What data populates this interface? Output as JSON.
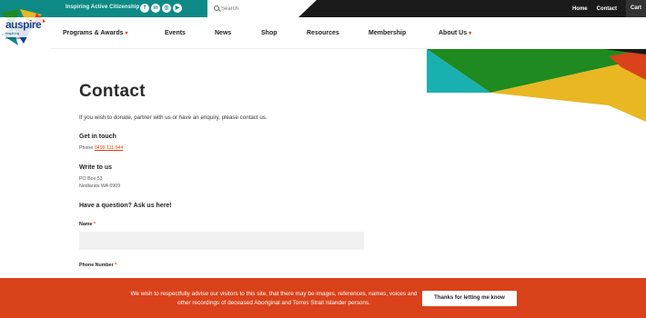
{
  "topbar": {
    "tagline": "Inspiring Active Citizenship",
    "social_icons": [
      "facebook-icon",
      "linkedin-icon",
      "instagram-icon",
      "youtube-icon"
    ],
    "search_placeholder": "Search",
    "links": [
      "Home",
      "Contact"
    ],
    "cart": "Cart"
  },
  "logo": {
    "name": "auspire",
    "sub": [
      "Inspiring",
      "Australians"
    ]
  },
  "nav": {
    "items": [
      {
        "label": "Programs & Awards",
        "dropdown": true
      },
      {
        "label": "Events",
        "dropdown": false
      },
      {
        "label": "News",
        "dropdown": false
      },
      {
        "label": "Shop",
        "dropdown": false
      },
      {
        "label": "Resources",
        "dropdown": false
      },
      {
        "label": "Membership",
        "dropdown": false
      },
      {
        "label": "About Us",
        "dropdown": true
      }
    ],
    "chevron": "▾"
  },
  "content": {
    "title": "Contact",
    "intro": "If you wish to donate, partner with us or have an enquiry, please contact us.",
    "get_in_touch": {
      "heading": "Get in touch",
      "phone_label": "Phone",
      "phone": "0499 111 944"
    },
    "write": {
      "heading": "Write to us",
      "line1": "PO Box 53",
      "line2": "Nedlands WA 6909"
    },
    "question_heading": "Have a question? Ask us here!",
    "form": {
      "name_label": "Name",
      "phone_label": "Phone Number",
      "required_mark": "*"
    }
  },
  "banner": {
    "text": "We wish to respectfully advise our visitors to this site, that there may be images, references, names, voices and other recordings of deceased Aboriginal and Torres Strait Islander persons.",
    "button": "Thanks for letting me know"
  },
  "colors": {
    "teal": "#0e8a86",
    "accent_orange": "#d9421b",
    "dark": "#1b1b1b",
    "yellow": "#e8b722",
    "green": "#1f8a1f"
  }
}
